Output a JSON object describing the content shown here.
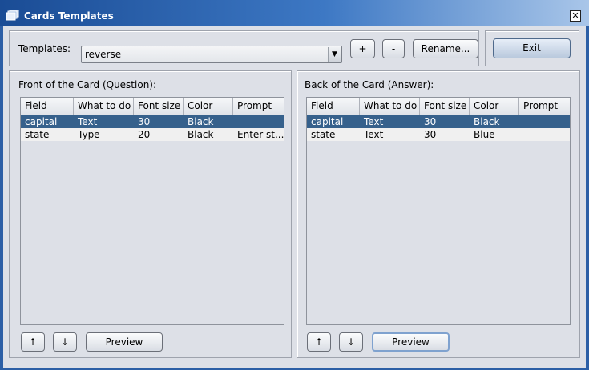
{
  "window": {
    "title": "Cards Templates",
    "close_glyph": "✕"
  },
  "templates": {
    "label": "Templates:",
    "selected": "reverse",
    "add_label": "+",
    "remove_label": "-",
    "rename_label": "Rename..."
  },
  "exit_label": "Exit",
  "columns": [
    "Field",
    "What to do",
    "Font size",
    "Color",
    "Prompt"
  ],
  "front": {
    "title": "Front of the Card (Question):",
    "rows": [
      [
        "capital",
        "Text",
        "30",
        "Black",
        ""
      ],
      [
        "state",
        "Type",
        "20",
        "Black",
        "Enter st..."
      ]
    ],
    "preview_label": "Preview"
  },
  "back": {
    "title": "Back of the Card (Answer):",
    "rows": [
      [
        "capital",
        "Text",
        "30",
        "Black",
        ""
      ],
      [
        "state",
        "Text",
        "30",
        "Blue",
        ""
      ]
    ],
    "preview_label": "Preview"
  },
  "arrows": {
    "up": "↑",
    "down": "↓"
  },
  "colors": {
    "selection": "#36618c",
    "title_bar": "#1a4c95"
  }
}
